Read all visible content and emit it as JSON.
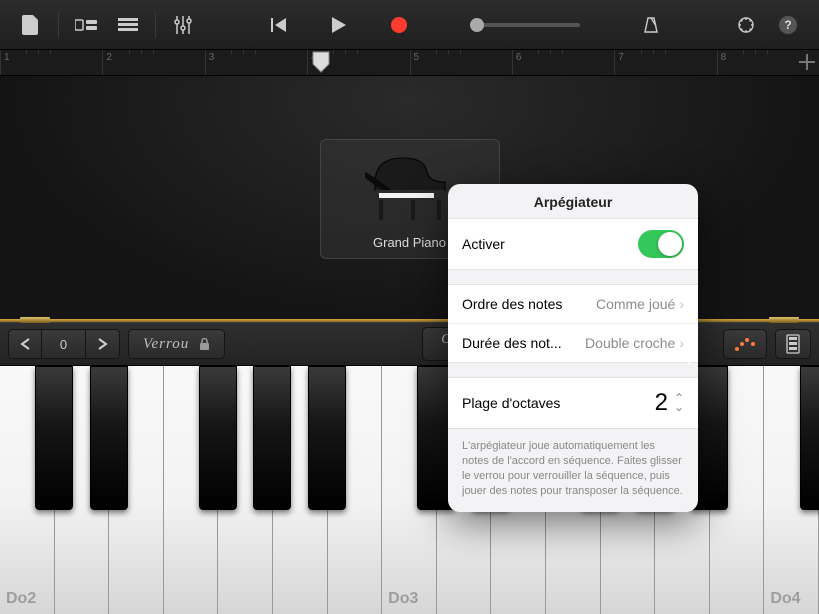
{
  "toolbar": {},
  "ruler": {
    "measures": [
      "1",
      "2",
      "3",
      "4",
      "5",
      "6",
      "7",
      "8"
    ]
  },
  "instrument": {
    "name": "Grand Piano"
  },
  "controls": {
    "octave": "0",
    "lock_label": "Verrou",
    "mode_label": "Glissando"
  },
  "keyboard": {
    "labels": [
      "Do2",
      "Do3",
      "Do4"
    ]
  },
  "popover": {
    "title": "Arpégiateur",
    "activate": "Activer",
    "note_order_label": "Ordre des notes",
    "note_order_value": "Comme joué",
    "note_rate_label": "Durée des not...",
    "note_rate_value": "Double croche",
    "octave_range_label": "Plage d'octaves",
    "octave_range_value": "2",
    "footer": "L'arpégiateur joue automatiquement les notes de l'accord en séquence. Faites glisser le verrou pour verrouiller la séquence, puis jouer des notes pour transposer la séquence."
  }
}
